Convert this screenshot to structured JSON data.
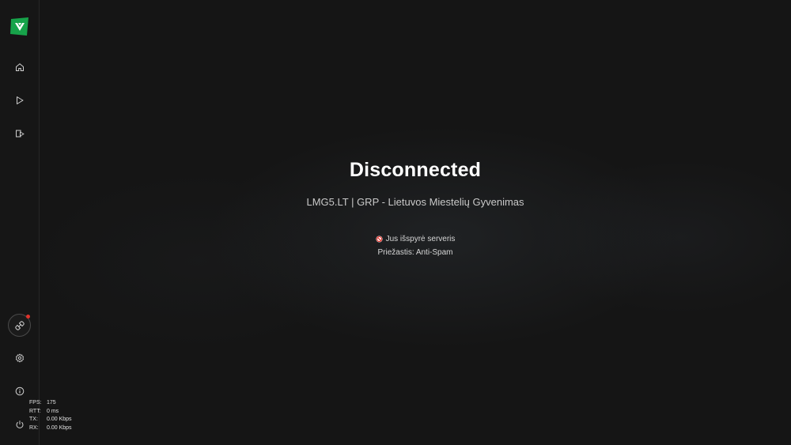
{
  "sidebar": {
    "logo_icon": "cfx-logo-icon",
    "brand_color": "#17a34a",
    "nav": [
      {
        "name": "home",
        "icon": "home-icon"
      },
      {
        "name": "play",
        "icon": "play-icon"
      },
      {
        "name": "replay",
        "icon": "replay-icon"
      }
    ],
    "bottom": [
      {
        "name": "plugins",
        "icon": "plugin-icon",
        "has_notification": true
      },
      {
        "name": "settings",
        "icon": "gear-icon"
      },
      {
        "name": "info",
        "icon": "info-icon"
      },
      {
        "name": "power",
        "icon": "power-icon"
      }
    ]
  },
  "main": {
    "title": "Disconnected",
    "server_name": "LMG5.LT | GRP - Lietuvos Miestelių Gyvenimas",
    "kick_message": "Jus išspyrė serveris",
    "reason": "Priežastis: Anti-Spam",
    "kick_icon": "ban-icon",
    "kick_icon_color": "#e0322b"
  },
  "stats": [
    {
      "label": "FPS:",
      "value": "175"
    },
    {
      "label": "RTT:",
      "value": "0 ms"
    },
    {
      "label": "TX:",
      "value": "0.00 Kbps"
    },
    {
      "label": "RX:",
      "value": "0.00 Kbps"
    }
  ]
}
